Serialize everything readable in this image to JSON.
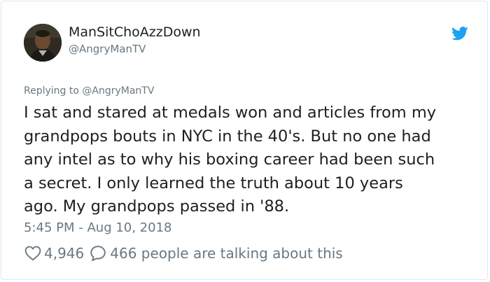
{
  "author": {
    "display_name": "ManSitChoAzzDown",
    "handle": "@AngryManTV",
    "avatar_icon": "profile-photo"
  },
  "tweet": {
    "reply_context": "Replying to @AngryManTV",
    "text": "I sat and stared at medals won and articles from my\ngrandpops bouts in NYC in the 40's. But no one had\nany intel as to why his boxing career had been such\na secret. I only learned the truth about 10 years\nago. My grandpops passed in '88.",
    "timestamp": "5:45 PM - Aug 10, 2018"
  },
  "actions": {
    "like_count": "4,946",
    "talking_text": "466 people are talking about this"
  },
  "icons": {
    "brand": "twitter-bird-icon",
    "like": "heart-icon",
    "reply": "speech-bubble-icon"
  },
  "colors": {
    "brand": "#1da1f2",
    "text_primary": "#1c2022",
    "text_secondary": "#697882",
    "border": "#e1e8ed"
  }
}
